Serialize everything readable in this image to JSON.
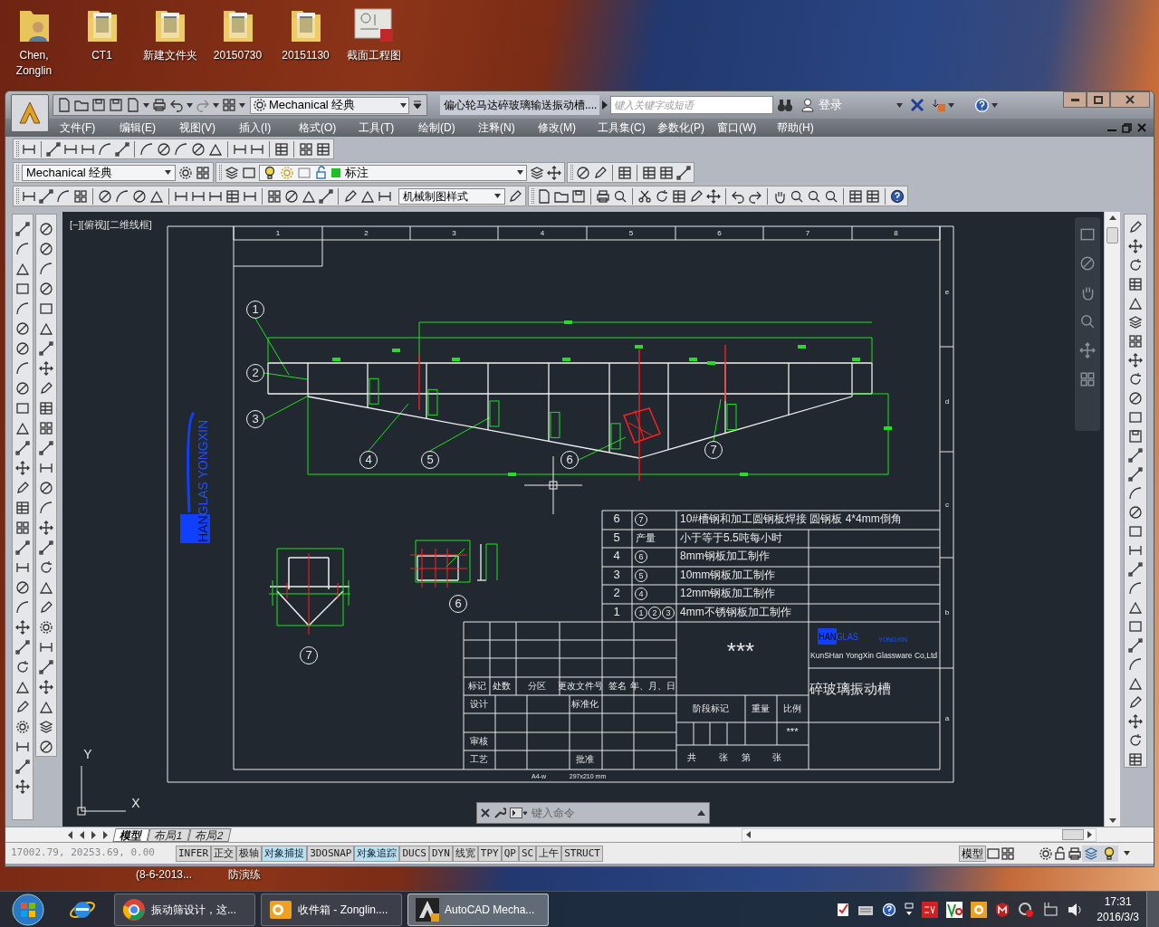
{
  "desktop": {
    "icons": [
      {
        "label": "Chen, Zonglin",
        "kind": "user-folder"
      },
      {
        "label": "CT1",
        "kind": "folder"
      },
      {
        "label": "新建文件夹",
        "kind": "folder"
      },
      {
        "label": "20150730",
        "kind": "folder"
      },
      {
        "label": "20151130",
        "kind": "folder"
      },
      {
        "label": "截面工程图",
        "kind": "drawing"
      }
    ],
    "hidden_labels": [
      "(8-6-2013...",
      "防演练"
    ]
  },
  "app": {
    "title": "偏心轮马达碎玻璃输送振动槽....",
    "workspace": "Mechanical 经典",
    "search": {
      "placeholder": "键入关键字或短语"
    },
    "sign_in": "登录"
  },
  "menus": [
    "文件(F)",
    "编辑(E)",
    "视图(V)",
    "插入(I)",
    "格式(O)",
    "工具(T)",
    "绘制(D)",
    "注释(N)",
    "修改(M)",
    "工具集(C)",
    "参数化(P)",
    "窗口(W)",
    "帮助(H)"
  ],
  "toolbars": {
    "workspace": "Mechanical 经典",
    "layer": "标注",
    "dimension_style": "机械制图样式"
  },
  "viewport": {
    "label": "[−][俯视][二维线框]"
  },
  "drawing": {
    "columns": [
      "1",
      "2",
      "3",
      "4",
      "5",
      "6",
      "7",
      "8"
    ],
    "rows": [
      "e",
      "d",
      "c",
      "b",
      "a"
    ],
    "logo": {
      "highlight": "HAN",
      "text": "GLAS YONGXIN"
    },
    "callouts": [
      "1",
      "2",
      "3",
      "4",
      "5",
      "6",
      "7",
      "6",
      "7"
    ],
    "parts": [
      {
        "no": "6",
        "refs": [
          {
            "kind": "circled",
            "text": "7"
          }
        ],
        "description": "10#槽钢和加工圆钢板焊接 圆钢板  4*4mm倒角"
      },
      {
        "no": "5",
        "refs": [
          {
            "kind": "plain",
            "text": "产量"
          }
        ],
        "description": "小于等于5.5吨每小时"
      },
      {
        "no": "4",
        "refs": [
          {
            "kind": "circled",
            "text": "6"
          }
        ],
        "description": "8mm钢板加工制作"
      },
      {
        "no": "3",
        "refs": [
          {
            "kind": "circled",
            "text": "5"
          }
        ],
        "description": "10mm钢板加工制作"
      },
      {
        "no": "2",
        "refs": [
          {
            "kind": "circled",
            "text": "4"
          }
        ],
        "description": "12mm钢板加工制作"
      },
      {
        "no": "1",
        "refs": [
          {
            "kind": "circled",
            "text": "1"
          },
          {
            "kind": "circled",
            "text": "2"
          },
          {
            "kind": "circled",
            "text": "3"
          }
        ],
        "description": "4mm不锈钢板加工制作"
      }
    ],
    "title_block": {
      "labels": [
        "标记",
        "处数",
        "分区",
        "更改文件号",
        "签名",
        "年、月、日",
        "设计",
        "标准化",
        "审核",
        "工艺",
        "批准",
        "阶段标记",
        "重量",
        "比例",
        "共",
        "张",
        "第",
        "张"
      ],
      "material": "***",
      "scale": "***",
      "title": "碎玻璃振动槽",
      "company": "KunSHan YongXin Glassware Co,Ltd",
      "logo_left": {
        "highlight": "HAN",
        "text": "GLAS"
      },
      "logo_right": "YONGXIN"
    },
    "sheet": [
      "A4-w",
      "297x210 mm"
    ],
    "ucs": {
      "x": "X",
      "y": "Y"
    }
  },
  "command_line": {
    "placeholder": "键入命令"
  },
  "layout_tabs": [
    {
      "label": "模型",
      "selected": true
    },
    {
      "label": "布局1",
      "selected": false
    },
    {
      "label": "布局2",
      "selected": false
    }
  ],
  "status_bar": {
    "coordinates": "17002.79, 20253.69, 0.00",
    "toggles": [
      {
        "label": "INFER",
        "on": false
      },
      {
        "label": "正交",
        "on": false
      },
      {
        "label": "极轴",
        "on": false
      },
      {
        "label": "对象捕捉",
        "on": true
      },
      {
        "label": "3DOSNAP",
        "on": false
      },
      {
        "label": "对象追踪",
        "on": true
      },
      {
        "label": "DUCS",
        "on": false
      },
      {
        "label": "DYN",
        "on": false
      },
      {
        "label": "线宽",
        "on": false
      },
      {
        "label": "TPY",
        "on": false
      },
      {
        "label": "QP",
        "on": false
      },
      {
        "label": "SC",
        "on": false
      },
      {
        "label": "上午",
        "on": false
      },
      {
        "label": "STRUCT",
        "on": false
      }
    ],
    "space": "模型"
  },
  "taskbar": {
    "items": [
      {
        "label": "振动筛设计，这...",
        "kind": "browser",
        "selected": false
      },
      {
        "label": "收件箱 - Zonglin....",
        "kind": "mail",
        "selected": false
      },
      {
        "label": "AutoCAD Mecha...",
        "kind": "cad",
        "selected": true
      }
    ],
    "time": "17:31",
    "date": "2016/3/3"
  }
}
